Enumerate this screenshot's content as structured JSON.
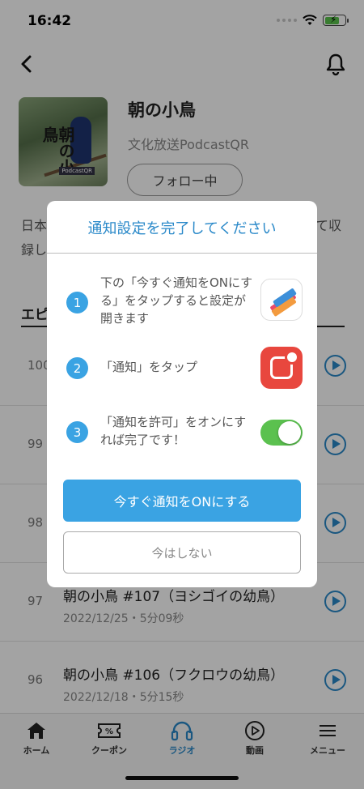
{
  "status_bar": {
    "time": "16:42"
  },
  "show": {
    "title": "朝の小鳥",
    "subtitle": "文化放送PodcastQR",
    "follow_label": "フォロー中",
    "cover_text": "朝の小鳥",
    "cover_logo": "PodcastQR",
    "desc_line1": "日本",
    "desc_line1_right": "て収",
    "desc_line2": "録し"
  },
  "episodes_section_label": "エピ",
  "episodes": [
    {
      "number": "100",
      "title": "",
      "meta": ""
    },
    {
      "number": "99",
      "title": "",
      "meta": ""
    },
    {
      "number": "98",
      "title": "",
      "meta": ""
    },
    {
      "number": "97",
      "title": "朝の小鳥 #107（ヨシゴイの幼鳥）",
      "meta": "2022/12/25・5分09秒"
    },
    {
      "number": "96",
      "title": "朝の小鳥 #106（フクロウの幼鳥）",
      "meta": "2022/12/18・5分15秒"
    }
  ],
  "tabbar": {
    "items": [
      {
        "label": "ホーム",
        "icon": "home-icon"
      },
      {
        "label": "クーポン",
        "icon": "coupon-icon"
      },
      {
        "label": "ラジオ",
        "icon": "headphones-icon"
      },
      {
        "label": "動画",
        "icon": "play-circle-icon"
      },
      {
        "label": "メニュー",
        "icon": "menu-icon"
      }
    ],
    "active_index": 2
  },
  "modal": {
    "title": "通知設定を完了してください",
    "steps": [
      {
        "number": "1",
        "text": "下の「今すぐ通知をONにする」をタップすると設定が開きます",
        "icon": "app-icon"
      },
      {
        "number": "2",
        "text": "「通知」をタップ",
        "icon": "notification-settings-icon"
      },
      {
        "number": "3",
        "text": "「通知を許可」をオンにすれば完了です！",
        "icon": "toggle-switch-icon"
      }
    ],
    "primary_label": "今すぐ通知をONにする",
    "secondary_label": "今はしない"
  },
  "colors": {
    "accent": "#3aa3e3",
    "play": "#2a89c9",
    "toggle_on": "#5bc14f",
    "settings_red": "#e8473e"
  }
}
